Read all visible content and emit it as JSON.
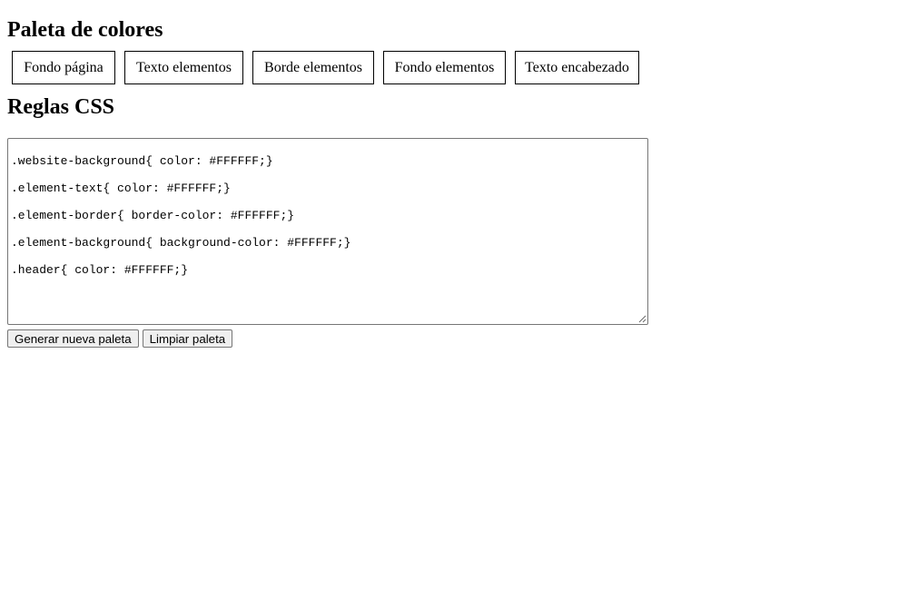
{
  "palette": {
    "title": "Paleta de colores",
    "swatches": [
      {
        "label": "Fondo página",
        "color": "#FFFFFF"
      },
      {
        "label": "Texto elementos",
        "color": "#FFFFFF"
      },
      {
        "label": "Borde elementos",
        "color": "#FFFFFF"
      },
      {
        "label": "Fondo elementos",
        "color": "#FFFFFF"
      },
      {
        "label": "Texto encabezado",
        "color": "#FFFFFF"
      }
    ]
  },
  "rules": {
    "title": "Reglas CSS",
    "lines": [
      ".website-background{ color: #FFFFFF;}",
      ".element-text{ color: #FFFFFF;}",
      ".element-border{ border-color: #FFFFFF;}",
      ".element-background{ background-color: #FFFFFF;}",
      ".header{ color: #FFFFFF;}"
    ]
  },
  "actions": {
    "generate_label": "Generar nueva paleta",
    "clear_label": "Limpiar paleta"
  }
}
